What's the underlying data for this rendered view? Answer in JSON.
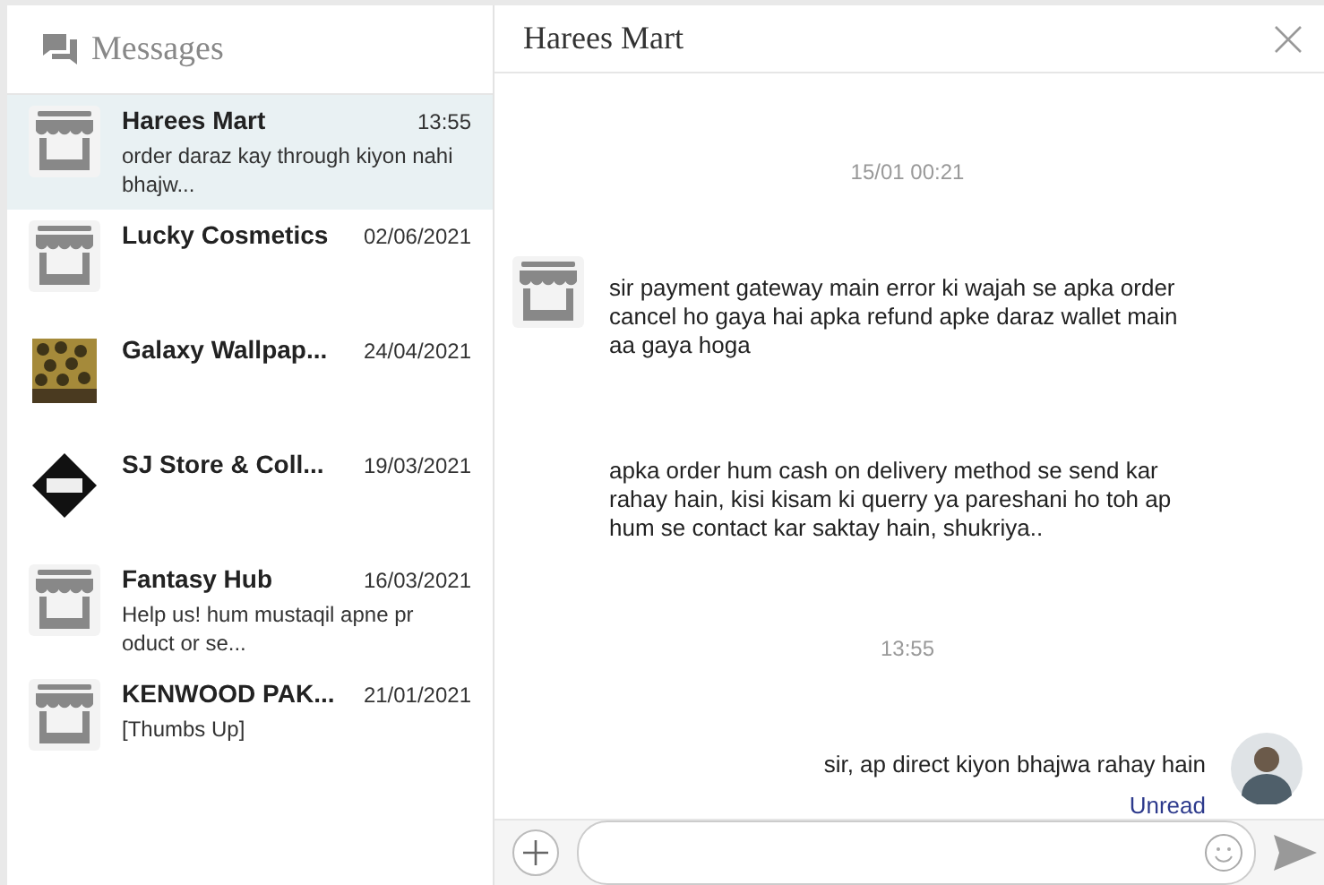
{
  "sidebar": {
    "title": "Messages",
    "conversations": [
      {
        "name": "Harees Mart",
        "time": "13:55",
        "preview": "order daraz kay through kiyon nahi bhajw...",
        "kind": "store",
        "selected": true
      },
      {
        "name": "Lucky Cosmetics",
        "time": "02/06/2021",
        "kind": "store",
        "selected": false
      },
      {
        "name": "Galaxy Wallpap...",
        "time": "24/04/2021",
        "kind": "picture",
        "selected": false
      },
      {
        "name": "SJ Store & Coll...",
        "time": "19/03/2021",
        "kind": "logo",
        "selected": false
      },
      {
        "name": "Fantasy Hub",
        "time": "16/03/2021",
        "preview": "Help us! hum mustaqil apne pr oduct or se...",
        "kind": "store",
        "selected": false
      },
      {
        "name": "KENWOOD PAK...",
        "time": "21/01/2021",
        "preview": "[Thumbs Up]",
        "kind": "store",
        "selected": false
      }
    ]
  },
  "chat": {
    "title": "Harees Mart",
    "messages": [
      {
        "kind": "time",
        "text": "15/01 00:21"
      },
      {
        "kind": "incoming",
        "text": "sir payment gateway main error ki wajah se apka order cancel ho gaya hai apka refund apke daraz wallet main aa gaya hoga",
        "avatar": true
      },
      {
        "kind": "incoming",
        "text": "apka order hum cash on delivery method se send kar rahay hain, kisi kisam ki querry ya pareshani ho toh ap hum se contact kar saktay hain, shukriya..",
        "avatar": false
      },
      {
        "kind": "time",
        "text": "13:55"
      },
      {
        "kind": "outgoing",
        "text": "sir, ap direct kiyon bhajwa rahay hain",
        "status": "Unread"
      }
    ]
  }
}
